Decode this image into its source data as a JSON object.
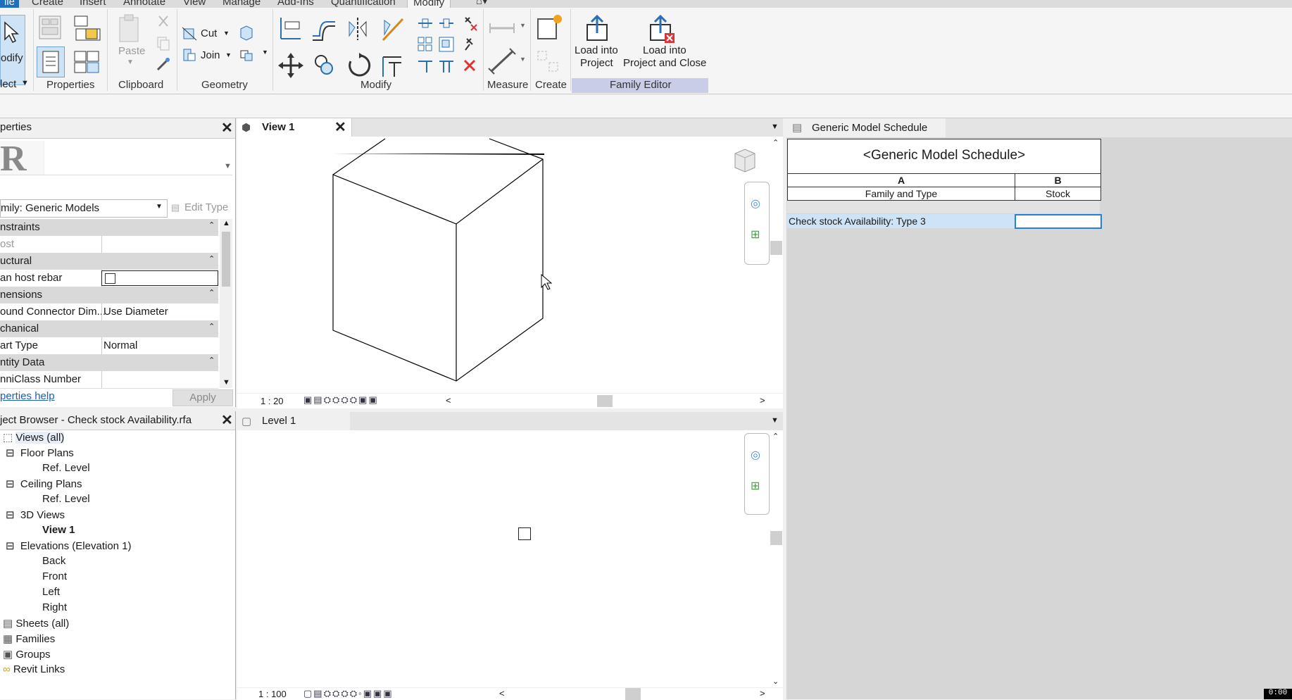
{
  "ribbon_tabs": [
    {
      "label": "ile"
    },
    {
      "label": "Create"
    },
    {
      "label": "Insert"
    },
    {
      "label": "Annotate"
    },
    {
      "label": "View"
    },
    {
      "label": "Manage"
    },
    {
      "label": "Add-Ins"
    },
    {
      "label": "Quantification"
    },
    {
      "label": "Modify"
    }
  ],
  "ribbon": {
    "modify_label": "odify",
    "select_label": "lect",
    "panels": {
      "properties": "Properties",
      "clipboard": "Clipboard",
      "geometry": "Geometry",
      "modify": "Modify",
      "measure": "Measure",
      "create": "Create",
      "family_editor": "Family Editor"
    },
    "paste": "Paste",
    "cut": "Cut",
    "join": "Join",
    "load_into_project_1": "Load into",
    "load_into_project_2": "Project",
    "load_close_1": "Load into",
    "load_close_2": "Project and Close"
  },
  "properties": {
    "title": "perties",
    "family_select": "mily: Generic Models",
    "edit_type": "Edit Type",
    "rows": [
      {
        "kind": "head",
        "label": "nstraints"
      },
      {
        "kind": "cell",
        "label": "ost",
        "value": ""
      },
      {
        "kind": "head",
        "label": "uctural"
      },
      {
        "kind": "cell",
        "label": "an host rebar",
        "value": ""
      },
      {
        "kind": "head",
        "label": "nensions"
      },
      {
        "kind": "cell",
        "label": "ound Connector Dim...",
        "value": "Use Diameter"
      },
      {
        "kind": "head",
        "label": "chanical"
      },
      {
        "kind": "cell",
        "label": "art Type",
        "value": "Normal"
      },
      {
        "kind": "head",
        "label": "ntity Data"
      },
      {
        "kind": "cell",
        "label": "nniClass Number",
        "value": ""
      }
    ],
    "help": "perties help",
    "apply": "Apply"
  },
  "browser": {
    "title": "ject Browser - Check stock Availability.rfa",
    "items": [
      {
        "label": "Views (all)"
      },
      {
        "label": "Floor Plans"
      },
      {
        "label": "Ref. Level"
      },
      {
        "label": "Ceiling Plans"
      },
      {
        "label": "Ref. Level"
      },
      {
        "label": "3D Views"
      },
      {
        "label": "View 1"
      },
      {
        "label": "Elevations (Elevation 1)"
      },
      {
        "label": "Back"
      },
      {
        "label": "Front"
      },
      {
        "label": "Left"
      },
      {
        "label": "Right"
      },
      {
        "label": "Sheets (all)"
      },
      {
        "label": "Families"
      },
      {
        "label": "Groups"
      },
      {
        "label": "Revit Links"
      }
    ]
  },
  "view1": {
    "tab": "View 1",
    "scale": "1 : 20"
  },
  "level1": {
    "tab": "Level 1",
    "scale": "1 : 100"
  },
  "schedule": {
    "tab": "Generic Model Schedule",
    "title": "<Generic Model Schedule>",
    "col_a": "A",
    "col_b": "B",
    "head_a": "Family and Type",
    "head_b": "Stock",
    "row_a": "Check stock Availability: Type 3",
    "row_b": ""
  },
  "status": "0:00"
}
